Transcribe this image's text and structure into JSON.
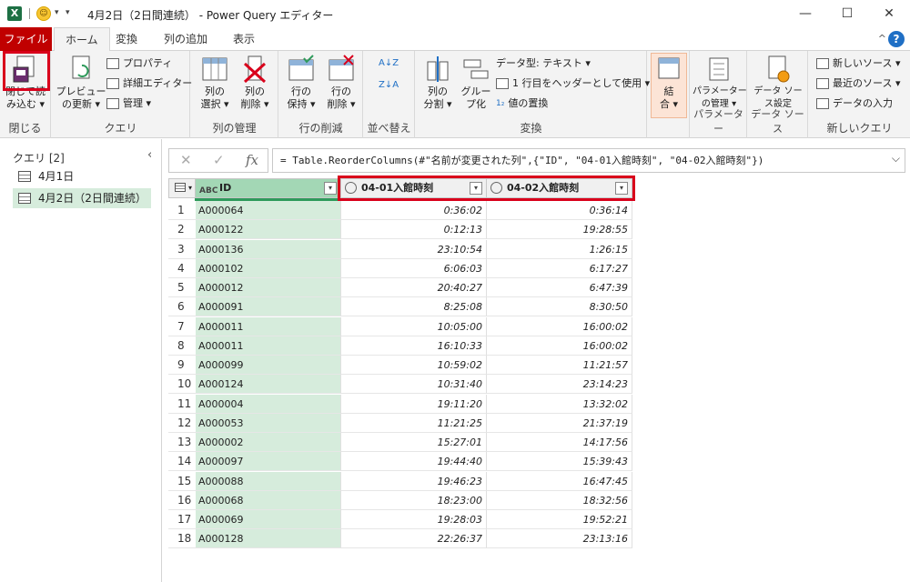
{
  "window": {
    "title": "4月2日（2日間連続） - Power Query エディター"
  },
  "tabs": [
    "ファイル",
    "ホーム",
    "変換",
    "列の追加",
    "表示"
  ],
  "ribbon": {
    "close": {
      "btn": "閉じて読\nみ込む ▾",
      "label": "閉じる"
    },
    "query": {
      "preview": "プレビュー\nの更新 ▾",
      "properties": "プロパティ",
      "advanced_editor": "詳細エディター",
      "manage": "管理 ▾",
      "label": "クエリ"
    },
    "manage_columns": {
      "select": "列の\n選択 ▾",
      "remove": "列の\n削除 ▾",
      "label": "列の管理"
    },
    "reduce_rows": {
      "keep": "行の\n保持 ▾",
      "remove": "行の\n削除 ▾",
      "label": "行の削減"
    },
    "sort": {
      "label": "並べ替え"
    },
    "transform": {
      "split": "列の\n分割 ▾",
      "group": "グルー\nプ化",
      "datatype": "データ型: テキスト ▾",
      "header": "1 行目をヘッダーとして使用 ▾",
      "replace": "値の置換",
      "label": "変換"
    },
    "combine": {
      "btn": "結\n合 ▾"
    },
    "parameters": {
      "btn": "パラメーター\nの管理 ▾",
      "label": "パラメーター"
    },
    "datasource": {
      "btn": "データ ソー\nス設定",
      "label": "データ ソース"
    },
    "new_query": {
      "new_source": "新しいソース ▾",
      "recent": "最近のソース ▾",
      "enter": "データの入力",
      "label": "新しいクエリ"
    }
  },
  "query_pane": {
    "title": "クエリ [2]",
    "items": [
      "4月1日",
      "4月2日（2日間連続）"
    ]
  },
  "formula": "= Table.ReorderColumns(#\"名前が変更された列\",{\"ID\", \"04-01入館時刻\", \"04-02入館時刻\"})",
  "columns": [
    "ID",
    "04-01入館時刻",
    "04-02入館時刻"
  ],
  "col_type_id": "ABC",
  "rows": [
    [
      "A000064",
      "0:36:02",
      "0:36:14"
    ],
    [
      "A000122",
      "0:12:13",
      "19:28:55"
    ],
    [
      "A000136",
      "23:10:54",
      "1:26:15"
    ],
    [
      "A000102",
      "6:06:03",
      "6:17:27"
    ],
    [
      "A000012",
      "20:40:27",
      "6:47:39"
    ],
    [
      "A000091",
      "8:25:08",
      "8:30:50"
    ],
    [
      "A000011",
      "10:05:00",
      "16:00:02"
    ],
    [
      "A000011",
      "16:10:33",
      "16:00:02"
    ],
    [
      "A000099",
      "10:59:02",
      "11:21:57"
    ],
    [
      "A000124",
      "10:31:40",
      "23:14:23"
    ],
    [
      "A000004",
      "19:11:20",
      "13:32:02"
    ],
    [
      "A000053",
      "11:21:25",
      "21:37:19"
    ],
    [
      "A000002",
      "15:27:01",
      "14:17:56"
    ],
    [
      "A000097",
      "19:44:40",
      "15:39:43"
    ],
    [
      "A000088",
      "19:46:23",
      "16:47:45"
    ],
    [
      "A000068",
      "18:23:00",
      "18:32:56"
    ],
    [
      "A000069",
      "19:28:03",
      "19:52:21"
    ],
    [
      "A000128",
      "22:26:37",
      "23:13:16"
    ]
  ]
}
